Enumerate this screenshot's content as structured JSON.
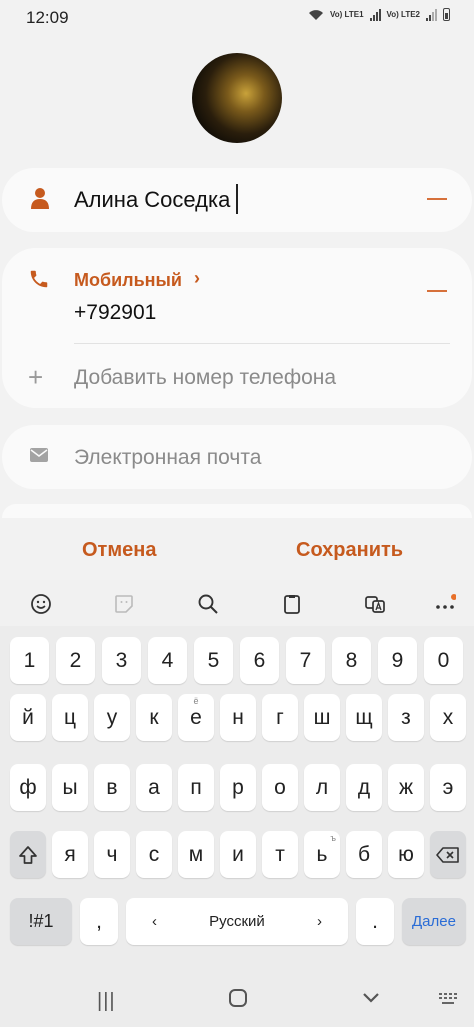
{
  "status": {
    "time": "12:09",
    "sim1": "Vo) LTE1",
    "sim2": "Vo) LTE2"
  },
  "contact": {
    "name": "Алина Соседка",
    "phone_type": "Мобильный",
    "phone_number": "+792901",
    "add_phone_placeholder": "Добавить номер телефона",
    "email_placeholder": "Электронная почта"
  },
  "actions": {
    "cancel": "Отмена",
    "save": "Сохранить"
  },
  "accent_color": "#c65a1e",
  "keyboard": {
    "toolbar_icons": [
      "emoji-icon",
      "sticker-icon",
      "search-icon",
      "clipboard-icon",
      "translate-icon",
      "more-icon"
    ],
    "row_numbers": [
      "1",
      "2",
      "3",
      "4",
      "5",
      "6",
      "7",
      "8",
      "9",
      "0"
    ],
    "row1": [
      "й",
      "ц",
      "у",
      "к",
      "е",
      "н",
      "г",
      "ш",
      "щ",
      "з",
      "х"
    ],
    "row1_hint": "ё",
    "row2": [
      "ф",
      "ы",
      "в",
      "а",
      "п",
      "р",
      "о",
      "л",
      "д",
      "ж",
      "э"
    ],
    "row3": [
      "я",
      "ч",
      "с",
      "м",
      "и",
      "т",
      "ь",
      "б",
      "ю"
    ],
    "row3_hint": "ъ",
    "symbols": "!#1",
    "comma": ",",
    "space_lang": "Русский",
    "lang_prev": "‹",
    "lang_next": "›",
    "period": ".",
    "next": "Далее"
  }
}
